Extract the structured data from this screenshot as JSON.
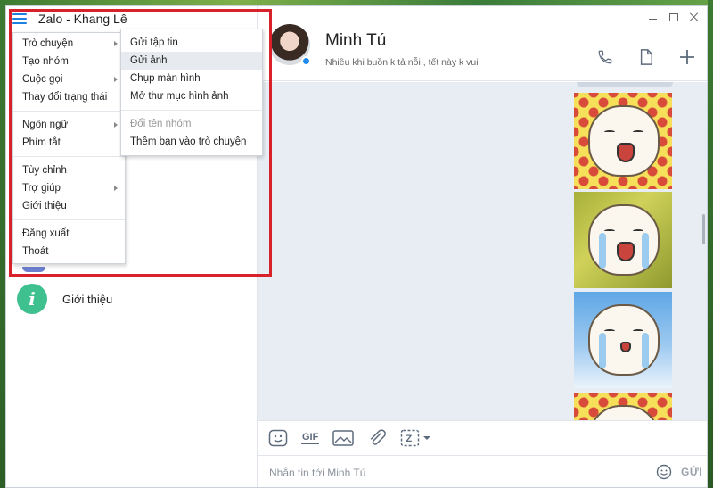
{
  "app": {
    "title": "Zalo - Khang Lê"
  },
  "menu": {
    "items": [
      {
        "label": "Trò chuyện",
        "submenu": true
      },
      {
        "label": "Tạo nhóm"
      },
      {
        "label": "Cuộc gọi",
        "submenu": true
      },
      {
        "label": "Thay đổi trạng thái"
      },
      {
        "label": "Ngôn ngữ",
        "submenu": true
      },
      {
        "label": "Phím tắt"
      },
      {
        "label": "Tùy chỉnh"
      },
      {
        "label": "Trợ giúp",
        "submenu": true
      },
      {
        "label": "Giới thiệu"
      },
      {
        "label": "Đăng xuất"
      },
      {
        "label": "Thoát"
      }
    ]
  },
  "submenu": {
    "items": [
      {
        "label": "Gửi tập tin"
      },
      {
        "label": "Gửi ảnh",
        "highlighted": true
      },
      {
        "label": "Chụp màn hình"
      },
      {
        "label": "Mở thư mục hình ảnh"
      },
      {
        "label": "Đổi tên nhóm",
        "disabled": true
      },
      {
        "label": "Thêm bạn vào trò chuyện"
      }
    ]
  },
  "sidebar": {
    "about_label": "Giới thiệu",
    "about_icon": "info-icon"
  },
  "chat": {
    "contact_name": "Minh Tú",
    "contact_status": "Nhiều khi buồn k tả nỗi , tết này k vui",
    "online": true
  },
  "toolbar": {
    "gif_label": "GIF"
  },
  "composer": {
    "placeholder": "Nhắn tin tới Minh Tú",
    "send_label": "GỬI"
  },
  "colors": {
    "accent": "#1d7fe0",
    "highlight_border": "#d8222b",
    "info_green": "#3ec08f",
    "chat_bg": "#e8edf3"
  }
}
